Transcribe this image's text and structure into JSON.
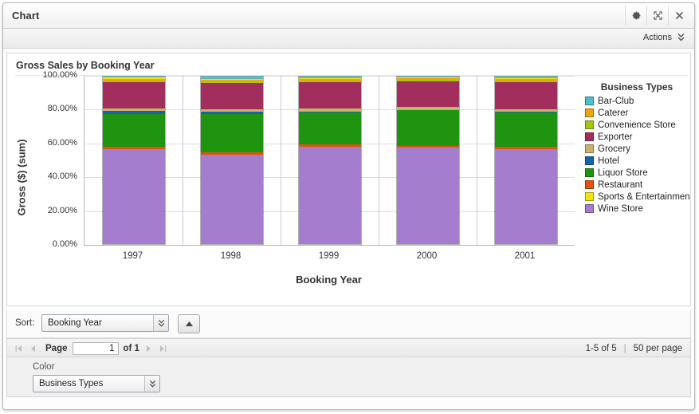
{
  "window": {
    "title": "Chart",
    "buttons": [
      {
        "name": "gear-icon",
        "label": "Settings"
      },
      {
        "name": "expand-icon",
        "label": "Maximize"
      },
      {
        "name": "close-icon",
        "label": "Close"
      }
    ]
  },
  "toolbar": {
    "actions_label": "Actions"
  },
  "chart_data": {
    "type": "bar",
    "stacked": true,
    "normalized": true,
    "title": "Gross Sales by Booking Year",
    "xlabel": "Booking Year",
    "ylabel": "Gross ($) (sum)",
    "categories": [
      "1997",
      "1998",
      "1999",
      "2000",
      "2001"
    ],
    "ylim": [
      0,
      100
    ],
    "ytick_labels": [
      "0.00%",
      "20.00%",
      "40.00%",
      "60.00%",
      "80.00%",
      "100.00%"
    ],
    "ytick_values": [
      0,
      20,
      40,
      60,
      80,
      100
    ],
    "grid": true,
    "legend_position": "right",
    "legend_title": "Business Types",
    "series": [
      {
        "name": "Wine Store",
        "color": "#a47dce",
        "values": [
          56.8,
          53.2,
          58.3,
          57.4,
          56.9
        ]
      },
      {
        "name": "Restaurant",
        "color": "#e2540d",
        "values": [
          1.4,
          1.5,
          1.2,
          1.3,
          1.4
        ]
      },
      {
        "name": "Liquor Store",
        "color": "#1f9410",
        "values": [
          19.6,
          23.0,
          19.3,
          21.1,
          20.2
        ]
      },
      {
        "name": "Hotel",
        "color": "#1066ad",
        "values": [
          1.6,
          1.3,
          0.5,
          0.4,
          0.5
        ]
      },
      {
        "name": "Grocery",
        "color": "#c5b469",
        "values": [
          1.5,
          1.6,
          1.6,
          1.5,
          1.5
        ]
      },
      {
        "name": "Exporter",
        "color": "#a12e5c",
        "values": [
          15.9,
          15.4,
          16.0,
          15.6,
          16.4
        ]
      },
      {
        "name": "Convenience Store",
        "color": "#a3c715",
        "values": [
          0.9,
          0.9,
          0.8,
          0.8,
          0.8
        ]
      },
      {
        "name": "Caterer",
        "color": "#f2a50a",
        "values": [
          1.1,
          1.1,
          1.0,
          1.1,
          1.0
        ]
      },
      {
        "name": "Sports & Entertainment",
        "color": "#f2e40a",
        "values": [
          0.6,
          0.5,
          0.5,
          0.4,
          0.4
        ]
      },
      {
        "name": "Bar-Club",
        "color": "#4cc0c8",
        "values": [
          0.6,
          1.5,
          0.8,
          0.4,
          0.9
        ]
      }
    ],
    "legend_entries": [
      {
        "label": "Bar-Club",
        "color": "#4cc0c8"
      },
      {
        "label": "Caterer",
        "color": "#f2a50a"
      },
      {
        "label": "Convenience Store",
        "color": "#a3c715"
      },
      {
        "label": "Exporter",
        "color": "#a12e5c"
      },
      {
        "label": "Grocery",
        "color": "#c5b469"
      },
      {
        "label": "Hotel",
        "color": "#1066ad"
      },
      {
        "label": "Liquor Store",
        "color": "#1f9410"
      },
      {
        "label": "Restaurant",
        "color": "#e2540d"
      },
      {
        "label": "Sports & Entertainmen",
        "color": "#f2e40a"
      },
      {
        "label": "Wine Store",
        "color": "#a47dce"
      }
    ]
  },
  "sort": {
    "label": "Sort:",
    "value": "Booking Year",
    "direction_icon": "arrow-up-icon"
  },
  "pager": {
    "page_word": "Page",
    "page_value": "1",
    "of_text": "of 1",
    "range_text": "1-5 of 5",
    "separator": "|",
    "per_page_text": "50 per page"
  },
  "color_panel": {
    "label": "Color",
    "value": "Business Types"
  }
}
